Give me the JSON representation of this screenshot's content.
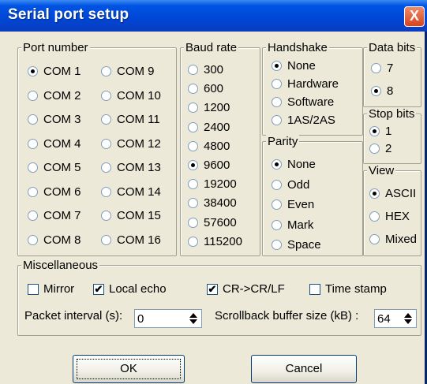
{
  "window": {
    "title": "Serial port setup",
    "close_glyph": "X"
  },
  "port_number": {
    "legend": "Port number",
    "col1": [
      {
        "label": "COM 1",
        "checked": true
      },
      {
        "label": "COM 2",
        "checked": false
      },
      {
        "label": "COM 3",
        "checked": false
      },
      {
        "label": "COM 4",
        "checked": false
      },
      {
        "label": "COM 5",
        "checked": false
      },
      {
        "label": "COM 6",
        "checked": false
      },
      {
        "label": "COM 7",
        "checked": false
      },
      {
        "label": "COM 8",
        "checked": false
      }
    ],
    "col2": [
      {
        "label": "COM 9",
        "checked": false
      },
      {
        "label": "COM 10",
        "checked": false
      },
      {
        "label": "COM 11",
        "checked": false
      },
      {
        "label": "COM 12",
        "checked": false
      },
      {
        "label": "COM 13",
        "checked": false
      },
      {
        "label": "COM 14",
        "checked": false
      },
      {
        "label": "COM 15",
        "checked": false
      },
      {
        "label": "COM 16",
        "checked": false
      }
    ]
  },
  "baud_rate": {
    "legend": "Baud rate",
    "options": [
      {
        "label": "300",
        "checked": false
      },
      {
        "label": "600",
        "checked": false
      },
      {
        "label": "1200",
        "checked": false
      },
      {
        "label": "2400",
        "checked": false
      },
      {
        "label": "4800",
        "checked": false
      },
      {
        "label": "9600",
        "checked": true
      },
      {
        "label": "19200",
        "checked": false
      },
      {
        "label": "38400",
        "checked": false
      },
      {
        "label": "57600",
        "checked": false
      },
      {
        "label": "115200",
        "checked": false
      }
    ]
  },
  "handshake": {
    "legend": "Handshake",
    "options": [
      {
        "label": "None",
        "checked": true
      },
      {
        "label": "Hardware",
        "checked": false
      },
      {
        "label": "Software",
        "checked": false
      },
      {
        "label": "1AS/2AS",
        "checked": false
      }
    ]
  },
  "parity": {
    "legend": "Parity",
    "options": [
      {
        "label": "None",
        "checked": true
      },
      {
        "label": "Odd",
        "checked": false
      },
      {
        "label": "Even",
        "checked": false
      },
      {
        "label": "Mark",
        "checked": false
      },
      {
        "label": "Space",
        "checked": false
      }
    ]
  },
  "data_bits": {
    "legend": "Data bits",
    "options": [
      {
        "label": "7",
        "checked": false
      },
      {
        "label": "8",
        "checked": true
      }
    ]
  },
  "stop_bits": {
    "legend": "Stop bits",
    "options": [
      {
        "label": "1",
        "checked": true
      },
      {
        "label": "2",
        "checked": false
      }
    ]
  },
  "view": {
    "legend": "View",
    "options": [
      {
        "label": "ASCII",
        "checked": true
      },
      {
        "label": "HEX",
        "checked": false
      },
      {
        "label": "Mixed",
        "checked": false
      }
    ]
  },
  "misc": {
    "legend": "Miscellaneous",
    "mirror": {
      "label": "Mirror",
      "checked": false
    },
    "local_echo": {
      "label": "Local echo",
      "checked": true
    },
    "cr_crlf": {
      "label": "CR->CR/LF",
      "checked": true
    },
    "time_stamp": {
      "label": "Time stamp",
      "checked": false
    },
    "packet_interval_label": "Packet interval (s):",
    "packet_interval_value": "0",
    "scrollback_label": "Scrollback buffer size (kB) :",
    "scrollback_value": "64"
  },
  "buttons": {
    "ok": "OK",
    "cancel": "Cancel"
  },
  "colors": {
    "titlebar": "#0054e3",
    "dialog_bg": "#ece9d8",
    "close_button": "#d8431b"
  },
  "icons": {
    "close": "close-icon",
    "spin_up": "chevron-up-icon",
    "spin_down": "chevron-down-icon",
    "check": "checkmark-icon"
  }
}
